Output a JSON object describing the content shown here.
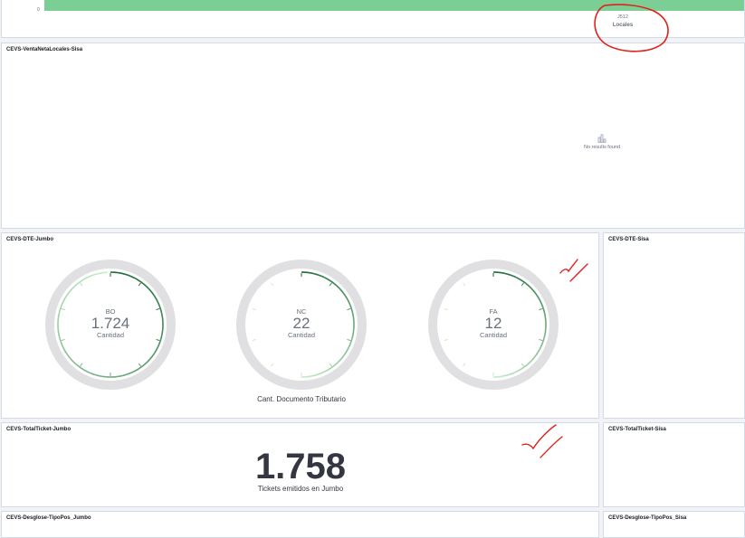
{
  "top_panel": {
    "axis_zero": "0",
    "bar_value": "J512",
    "bar_axis_label": "Locales"
  },
  "venta_panel": {
    "title": "CEVS-VentaNetaLocales-Sisa",
    "empty_text": "No results found",
    "empty_icon": "empty-chart-icon"
  },
  "dte_jumbo": {
    "title": "CEVS-DTE-Jumbo",
    "footer": "Cant. Documento Tributario",
    "gauges": [
      {
        "code": "BO",
        "value": "1.724",
        "unit": "Cantidad",
        "fill": 0.99
      },
      {
        "code": "NC",
        "value": "22",
        "unit": "Cantidad",
        "fill": 0.5
      },
      {
        "code": "FA",
        "value": "12",
        "unit": "Cantidad",
        "fill": 0.5
      }
    ]
  },
  "dte_sisa": {
    "title": "CEVS-DTE-Sisa"
  },
  "ticket_jumbo": {
    "title": "CEVS-TotalTicket-Jumbo",
    "value": "1.758",
    "caption": "Tickets emitidos en Jumbo"
  },
  "ticket_sisa": {
    "title": "CEVS-TotalTicket-Sisa"
  },
  "desglose_jumbo": {
    "title": "CEVS-Desglose-TipoPos_Jumbo"
  },
  "desglose_sisa": {
    "title": "CEVS-Desglose-TipoPos_Sisa"
  },
  "colors": {
    "bar": "#7ccf94",
    "annotation": "#e0201b",
    "gauge_track": "#e0e0e3",
    "gauge_dark": "#1a6b36",
    "gauge_light": "#c6ecc9",
    "panel_border": "#d3dae6"
  }
}
